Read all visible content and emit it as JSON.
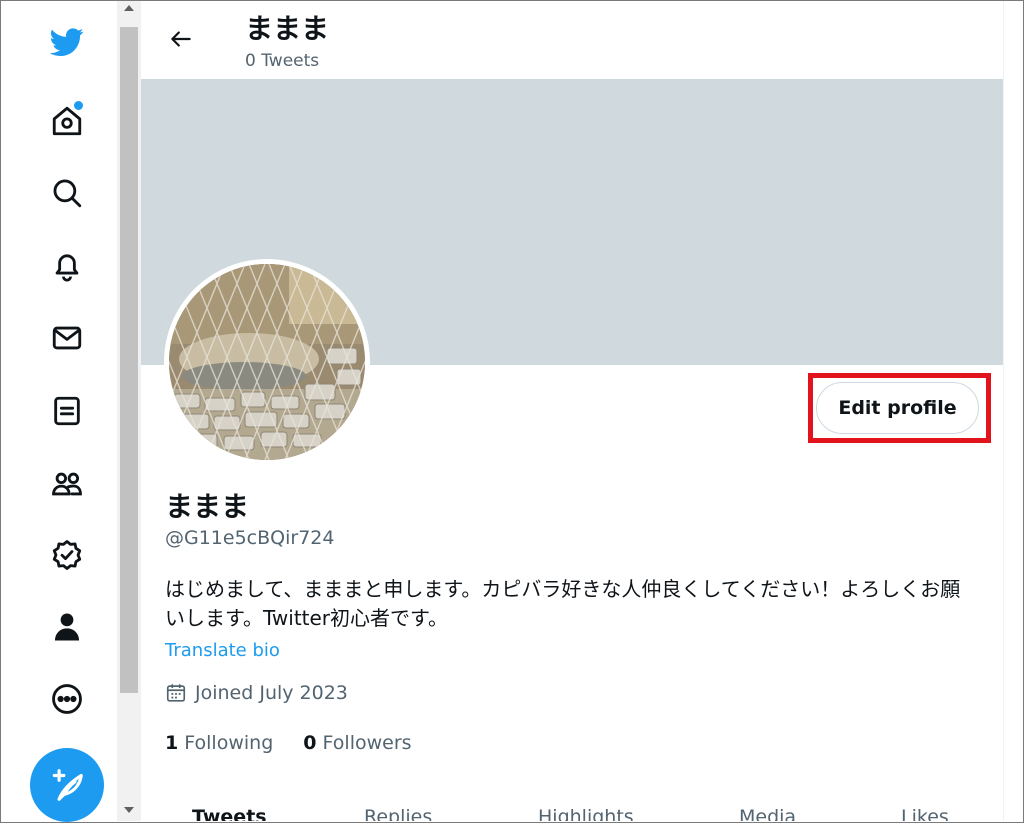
{
  "header": {
    "name": "ままま",
    "tweet_count": "0 Tweets"
  },
  "nav": {
    "items": [
      "twitter-logo",
      "home",
      "explore",
      "notifications",
      "messages",
      "lists",
      "communities",
      "verified",
      "profile",
      "more"
    ],
    "compose": "compose-tweet"
  },
  "profile": {
    "display_name": "ままま",
    "handle": "@G11e5cBQir724",
    "bio": "はじめまして、まままと申します。カピバラ好きな人仲良くしてください！よろしくお願いします。Twitter初心者です。",
    "translate_label": "Translate bio",
    "joined": "Joined July 2023",
    "following_count": "1",
    "following_label": "Following",
    "followers_count": "0",
    "followers_label": "Followers",
    "edit_button": "Edit profile"
  },
  "tabs": [
    "Tweets",
    "Replies",
    "Highlights",
    "Media",
    "Likes"
  ],
  "colors": {
    "accent": "#1d9bf0",
    "banner": "#cfd9de",
    "highlight": "#e3131b",
    "secondary_text": "#536471"
  }
}
